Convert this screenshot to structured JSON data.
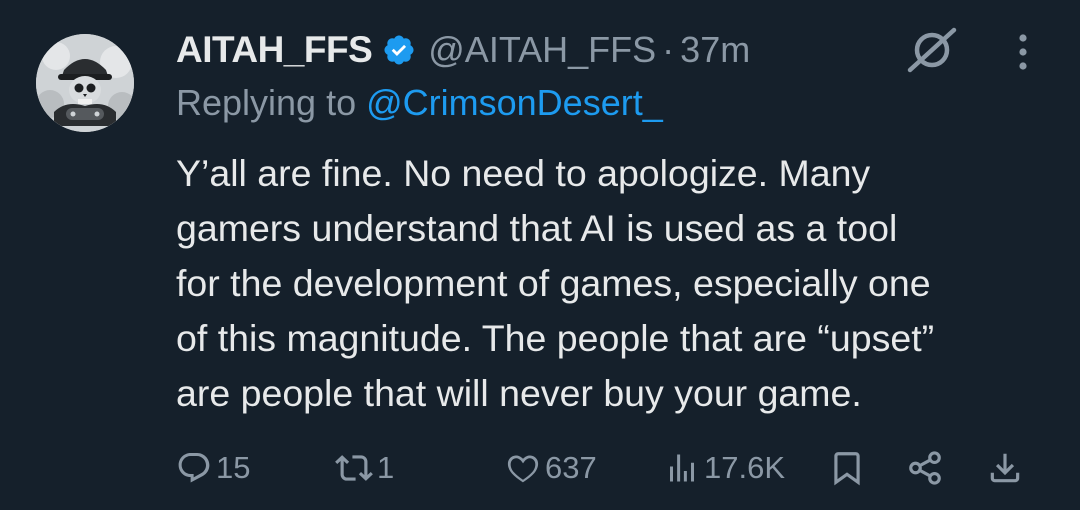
{
  "tweet": {
    "display_name": "AITAH_FFS",
    "handle": "@AITAH_FFS",
    "separator": "·",
    "time": "37m",
    "replying_prefix": "Replying to",
    "replying_handle": "@CrimsonDesert_",
    "body_lines": [
      "Y’all are fine. No need to apologize. Many",
      "gamers understand that AI is used as a tool",
      "for the development of games, especially one",
      "of this magnitude. The people that are “upset”",
      "are people that will never buy your game."
    ]
  },
  "actions": {
    "replies": "15",
    "reposts": "1",
    "likes": "637",
    "views": "17.6K"
  },
  "icons": {
    "verified": "verified-badge-icon",
    "hidden": "hidden-reply-icon",
    "more": "more-options-icon",
    "reply": "reply-icon",
    "repost": "repost-icon",
    "like": "heart-icon",
    "views": "views-icon",
    "bookmark": "bookmark-icon",
    "share": "share-icon",
    "download": "download-icon"
  },
  "colors": {
    "background": "#15202b",
    "text": "#e7e9ea",
    "muted": "#8b98a5",
    "accent": "#1d9bf0"
  }
}
